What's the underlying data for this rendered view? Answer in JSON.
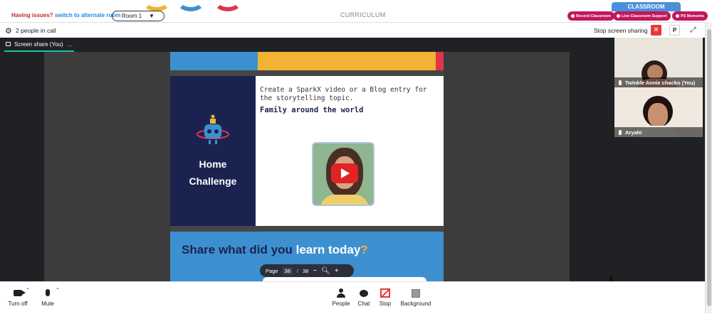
{
  "header": {
    "issues_text": "Having issues?",
    "alt_room_link": "switch to alternate room",
    "room_select": "Room 1",
    "curriculum": "CURRICULUM",
    "classroom_tab": "CLASSROOM",
    "record_pill": "Record Classroom",
    "support_pill": "Live Classroom Support",
    "moments_pill": "PS Moments"
  },
  "callbar": {
    "people_count": "2 people in call",
    "stop_share": "Stop screen sharing",
    "p_button": "P"
  },
  "stage": {
    "tab_label": "Screen share (You)",
    "tab_more": "…"
  },
  "slide": {
    "home_challenge_1": "Home",
    "home_challenge_2": "Challenge",
    "task": "Create a SparkX video or a Blog entry for the storytelling topic.",
    "topic": "Family around the world",
    "share_prefix": "Share what did you ",
    "share_highlight": "learn today",
    "share_q": "?"
  },
  "pager": {
    "label": "Page",
    "current": "38",
    "sep": "/",
    "total": "38",
    "zoom_out": "−",
    "zoom_in": "+"
  },
  "participants": [
    {
      "name": "Twinkle Annie chacko (You)"
    },
    {
      "name": "Aryahi"
    }
  ],
  "controls": {
    "turn_off": "Turn off",
    "mute": "Mute",
    "people": "People",
    "chat": "Chat",
    "stop": "Stop",
    "background": "Background"
  },
  "colors": {
    "accent_teal": "#19c3a2",
    "danger_red": "#e53935",
    "pill_magenta": "#c2185b",
    "classroom_blue": "#4a90d9"
  }
}
